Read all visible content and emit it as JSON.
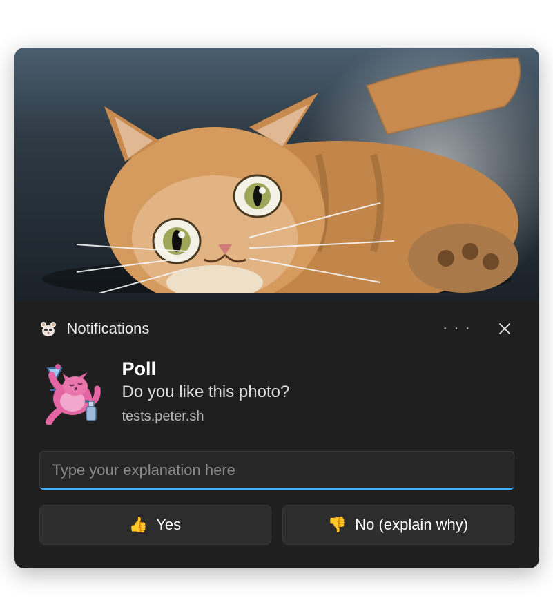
{
  "header": {
    "app_icon": "hamster-icon",
    "title": "Notifications",
    "more_icon": "ellipsis-icon",
    "close_icon": "close-icon"
  },
  "hero": {
    "image_description": "Orange tabby cat lying on its side looking at camera"
  },
  "content": {
    "avatar_icon": "pink-cat-cocktail-icon",
    "title": "Poll",
    "subtitle": "Do you like this photo?",
    "attribution": "tests.peter.sh"
  },
  "input": {
    "placeholder": "Type your explanation here",
    "value": ""
  },
  "actions": {
    "yes": {
      "emoji": "👍",
      "label": "Yes"
    },
    "no": {
      "emoji": "👎",
      "label": "No (explain why)"
    }
  }
}
